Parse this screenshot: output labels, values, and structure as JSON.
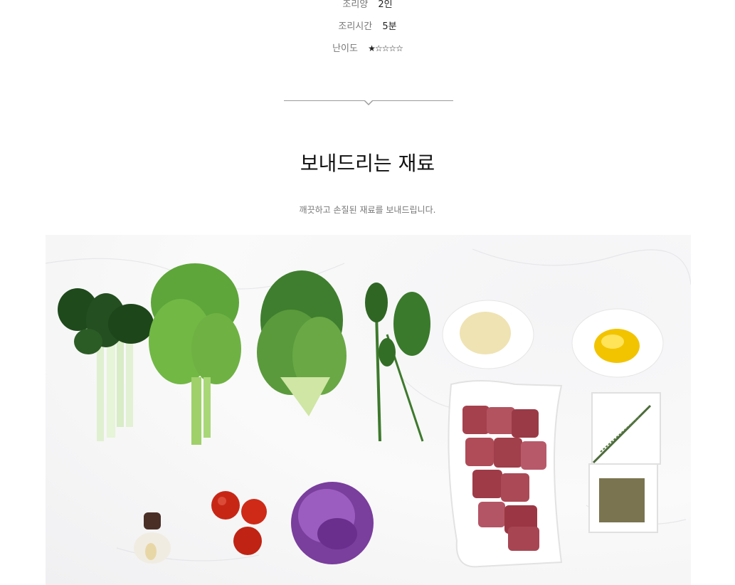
{
  "recipe_info": {
    "servings_label": "조리양",
    "servings_value": "2인",
    "time_label": "조리시간",
    "time_value": "5분",
    "difficulty_label": "난이도",
    "difficulty_value": "★☆☆☆☆",
    "difficulty_rating": 1,
    "difficulty_max": 5
  },
  "ingredients_section": {
    "title": "보내드리는 재료",
    "subtitle": "깨끗하고 손질된 재료를 보내드립니다."
  },
  "ingredients_photo": {
    "items": [
      "bok-choy",
      "frisee-lettuce",
      "romaine-lettuce",
      "arugula",
      "garlic",
      "cherry-tomato",
      "red-cabbage",
      "grated-cheese",
      "olive-oil",
      "beef-cubes",
      "rosemary",
      "dried-herbs"
    ]
  }
}
